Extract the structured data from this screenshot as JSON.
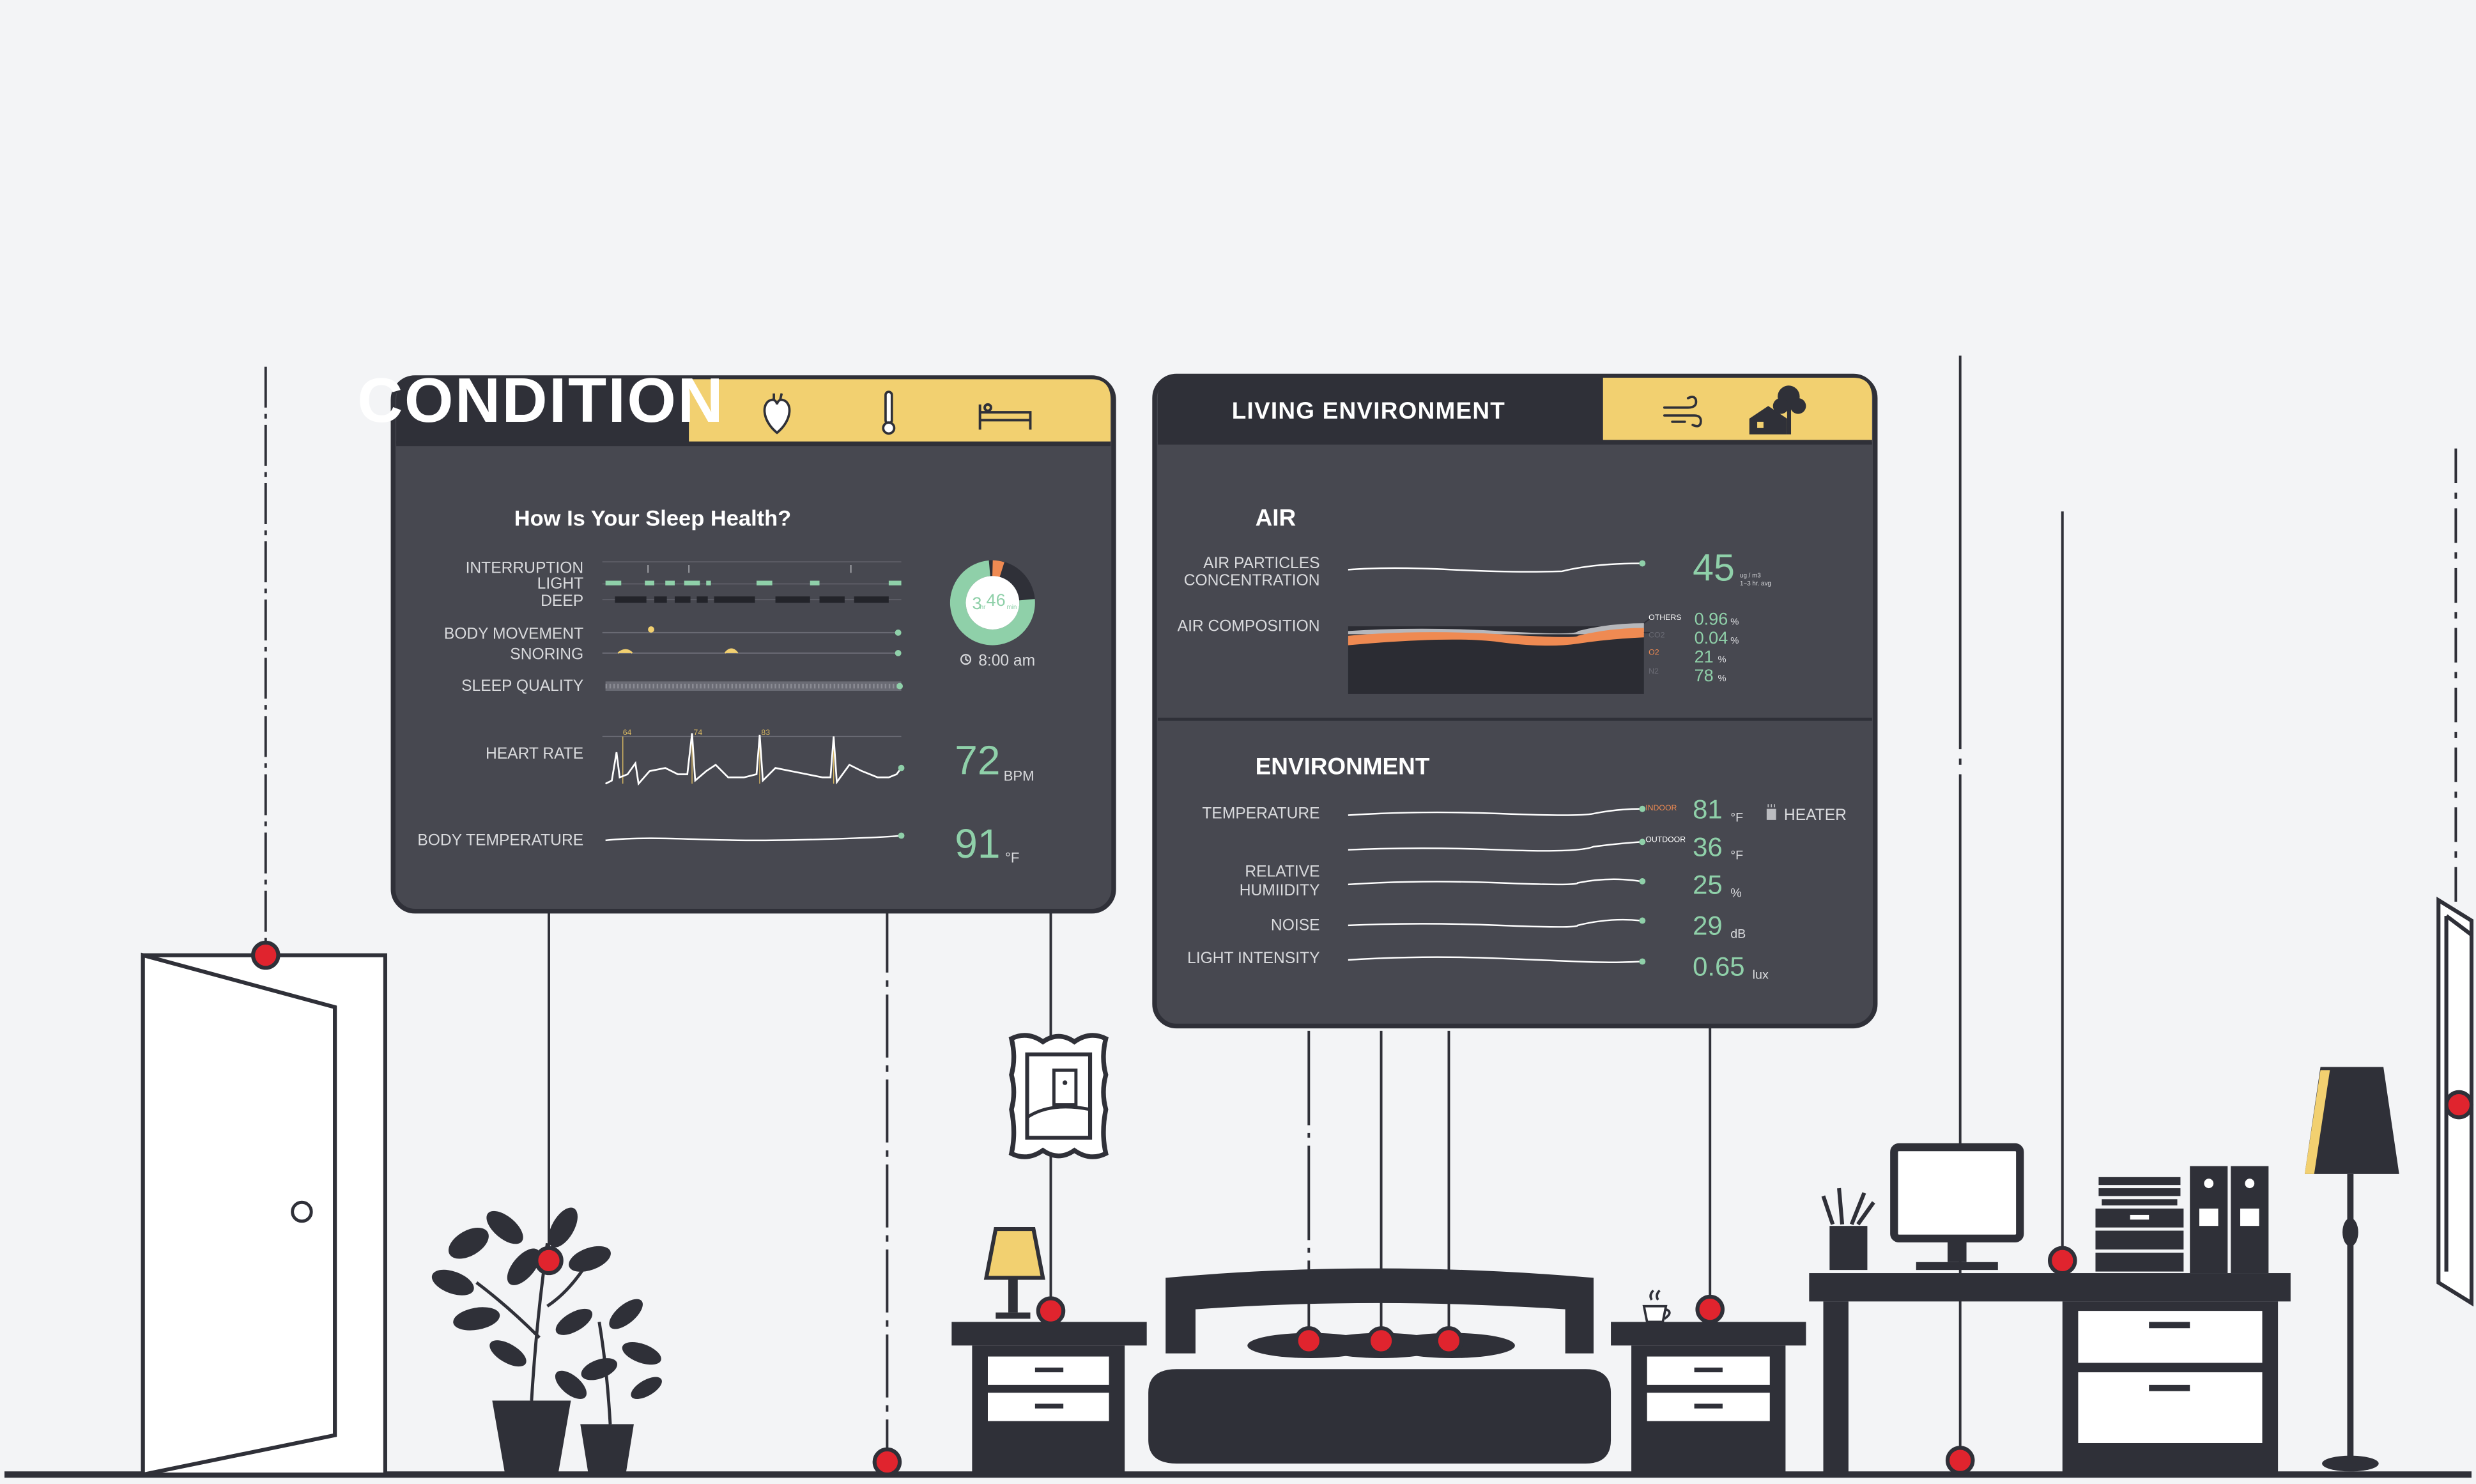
{
  "colors": {
    "background": "#f3f4f6",
    "panel": "#474850",
    "panel_header": "#2f3038",
    "accent_yellow": "#f2d070",
    "value_green": "#8fd0a9",
    "sensor_red": "#e0242e",
    "orange": "#ef8a52"
  },
  "condition": {
    "title": "CONDITION",
    "icons": [
      "heart-icon",
      "thermometer-icon",
      "bed-icon"
    ],
    "heading": "How Is Your Sleep Health?",
    "labels": {
      "interruption": "INTERRUPTION",
      "light": "LIGHT",
      "deep": "DEEP",
      "body_movement": "BODY MOVEMENT",
      "snoring": "SNORING",
      "sleep_quality": "SLEEP QUALITY",
      "heart_rate": "HEART RATE",
      "body_temperature": "BODY  TEMPERATURE"
    },
    "sleep_ring": {
      "hours": "3",
      "hr_unit": "hr",
      "minutes": "46",
      "min_unit": "min",
      "alarm": "8:00 am"
    },
    "heart_rate": {
      "value": "72",
      "unit": "BPM",
      "peaks": [
        "64",
        "74",
        "83"
      ]
    },
    "body_temperature": {
      "value": "91",
      "unit": "°F"
    }
  },
  "living": {
    "title": "LIVING ENVIRONMENT",
    "icons": [
      "wind-icon",
      "house-tree-icon"
    ],
    "air": {
      "heading": "AIR",
      "particles_label_1": "AIR PARTICLES",
      "particles_label_2": "CONCENTRATION",
      "particles_value": "45",
      "particles_unit_1": "ug / m3",
      "particles_unit_2": "1~3 hr. avg",
      "composition_label": "AIR COMPOSITION",
      "composition": [
        {
          "name": "OTHERS",
          "value": "0.96",
          "unit": "%"
        },
        {
          "name": "CO2",
          "value": "0.04",
          "unit": "%"
        },
        {
          "name": "O2",
          "value": "21",
          "unit": "%"
        },
        {
          "name": "N2",
          "value": "78",
          "unit": "%"
        }
      ]
    },
    "environment": {
      "heading": "ENVIRONMENT",
      "temperature_label": "TEMPERATURE",
      "indoor_tag": "INDOOR",
      "outdoor_tag": "OUTDOOR",
      "indoor_value": "81",
      "outdoor_value": "36",
      "temp_unit": "°F",
      "heater_label": "HEATER",
      "humidity_label_1": "RELATIVE",
      "humidity_label_2": "HUMIIDITY",
      "humidity_value": "25",
      "humidity_unit": "%",
      "noise_label": "NOISE",
      "noise_value": "29",
      "noise_unit": "dB",
      "light_label": "LIGHT INTENSITY",
      "light_value": "0.65",
      "light_unit": "lux"
    }
  },
  "room_objects": [
    "door",
    "potted-plants",
    "picture-frame",
    "table-lamp",
    "nightstand-left",
    "bed",
    "coffee-cup",
    "nightstand-right",
    "pencil-cup",
    "desktop-monitor",
    "paper-tray",
    "binders",
    "desk",
    "floor-lamp",
    "window"
  ]
}
